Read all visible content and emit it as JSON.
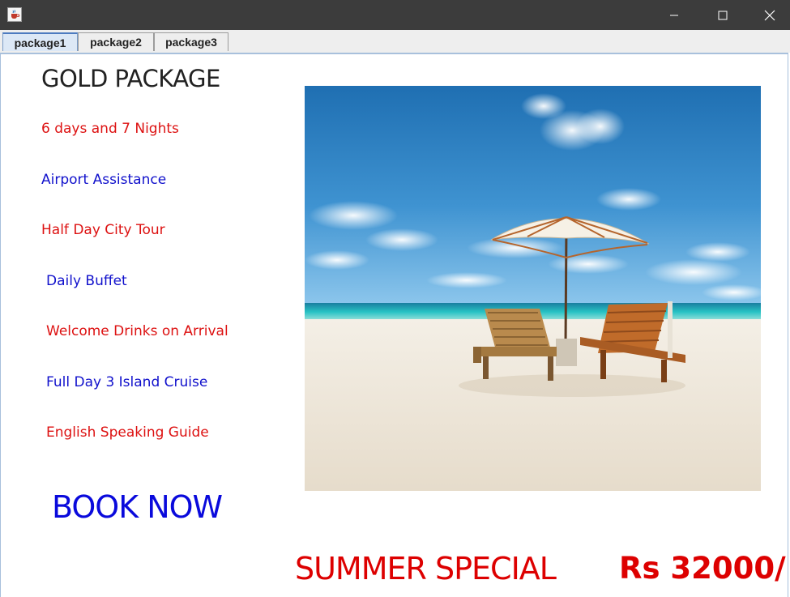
{
  "window": {
    "icon": "java-cup-icon"
  },
  "tabs": [
    {
      "label": "package1",
      "active": true
    },
    {
      "label": "package2",
      "active": false
    },
    {
      "label": "package3",
      "active": false
    }
  ],
  "package": {
    "title": "GOLD PACKAGE",
    "features": [
      {
        "label": "6 days and 7 Nights",
        "color": "#dd1111"
      },
      {
        "label": "Airport Assistance",
        "color": "#1111cc"
      },
      {
        "label": "Half Day City Tour",
        "color": "#dd1111"
      },
      {
        "label": "Daily Buffet",
        "color": "#1111cc"
      },
      {
        "label": "Welcome Drinks on Arrival",
        "color": "#dd1111"
      },
      {
        "label": "Full Day 3 Island Cruise",
        "color": "#1111cc"
      },
      {
        "label": "English Speaking Guide",
        "color": "#dd1111"
      }
    ],
    "book_label": "BOOK NOW",
    "promo_label": "SUMMER SPECIAL",
    "price_label": "Rs 32000/"
  },
  "colors": {
    "red": "#dd0000",
    "blue": "#0a0adc",
    "titlebar": "#3c3c3c"
  }
}
